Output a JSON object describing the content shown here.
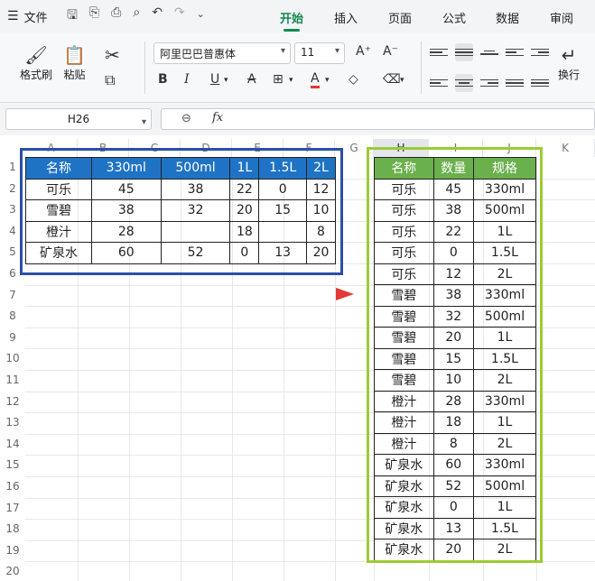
{
  "menubar": {
    "file_label": "文件",
    "tabs": [
      {
        "label": "开始",
        "active": true
      },
      {
        "label": "插入",
        "active": false
      },
      {
        "label": "页面",
        "active": false
      },
      {
        "label": "公式",
        "active": false
      },
      {
        "label": "数据",
        "active": false
      },
      {
        "label": "审阅",
        "active": false
      }
    ]
  },
  "ribbon": {
    "format_painter": "格式刷",
    "paste": "粘贴",
    "font_name": "阿里巴巴普惠体",
    "font_size": "11",
    "wrap": "换行"
  },
  "formula_bar": {
    "name_box": "H26",
    "fx": "fx",
    "formula": ""
  },
  "sheet": {
    "columns": [
      "A",
      "B",
      "C",
      "D",
      "E",
      "F",
      "G",
      "H",
      "I",
      "J",
      "K"
    ],
    "rows": [
      "1",
      "2",
      "3",
      "4",
      "5",
      "6",
      "7",
      "8",
      "9",
      "10",
      "11",
      "12",
      "13",
      "14",
      "15",
      "16",
      "17",
      "18",
      "19",
      "20"
    ],
    "selected_column": "H"
  },
  "source_table": {
    "header": [
      "名称",
      "330ml",
      "500ml",
      "1L",
      "1.5L",
      "2L"
    ],
    "rows": [
      [
        "可乐",
        "45",
        "38",
        "22",
        "0",
        "12"
      ],
      [
        "雪碧",
        "38",
        "32",
        "20",
        "15",
        "10"
      ],
      [
        "橙汁",
        "28",
        "",
        "18",
        "",
        "8"
      ],
      [
        "矿泉水",
        "60",
        "52",
        "0",
        "13",
        "20"
      ]
    ]
  },
  "result_table": {
    "header": [
      "名称",
      "数量",
      "规格"
    ],
    "rows": [
      [
        "可乐",
        "45",
        "330ml"
      ],
      [
        "可乐",
        "38",
        "500ml"
      ],
      [
        "可乐",
        "22",
        "1L"
      ],
      [
        "可乐",
        "0",
        "1.5L"
      ],
      [
        "可乐",
        "12",
        "2L"
      ],
      [
        "雪碧",
        "38",
        "330ml"
      ],
      [
        "雪碧",
        "32",
        "500ml"
      ],
      [
        "雪碧",
        "20",
        "1L"
      ],
      [
        "雪碧",
        "15",
        "1.5L"
      ],
      [
        "雪碧",
        "10",
        "2L"
      ],
      [
        "橙汁",
        "28",
        "330ml"
      ],
      [
        "橙汁",
        "18",
        "1L"
      ],
      [
        "橙汁",
        "8",
        "2L"
      ],
      [
        "矿泉水",
        "60",
        "330ml"
      ],
      [
        "矿泉水",
        "52",
        "500ml"
      ],
      [
        "矿泉水",
        "0",
        "1L"
      ],
      [
        "矿泉水",
        "13",
        "1.5L"
      ],
      [
        "矿泉水",
        "20",
        "2L"
      ]
    ]
  },
  "colors": {
    "accent": "#128a4e",
    "source_header": "#1f73c5",
    "source_frame": "#2a4fa8",
    "result_header": "#6ab04c",
    "result_frame": "#9acd32",
    "arrow": "#e53935"
  }
}
